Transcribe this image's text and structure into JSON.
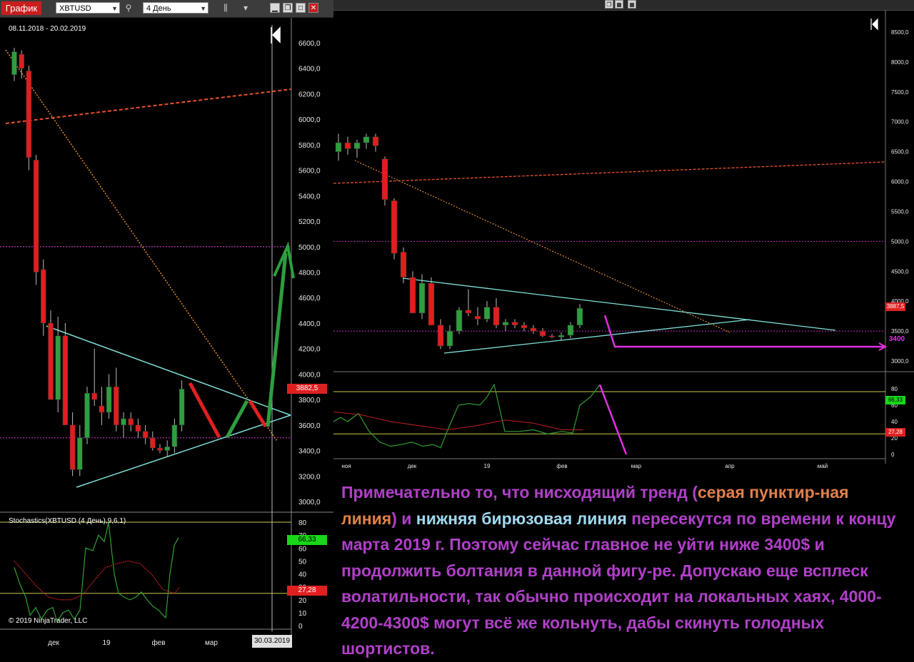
{
  "left_window": {
    "title": "График",
    "symbol": "XBTUSD",
    "interval": "4 День",
    "date_range": "08.11.2018 - 20.02.2019",
    "indicator_title": "Stochastics(XBTUSD (4 День),9,6,1)",
    "copyright": "© 2019 NinjaTrader, LLC",
    "date_badge": "30.03.2019",
    "price_tag_main": "3882,5",
    "price_tag_stoch_high": "66,33",
    "price_tag_stoch_low": "27,28",
    "price_axis": [
      "6600,0",
      "6400,0",
      "6200,0",
      "6000,0",
      "5800,0",
      "5600,0",
      "5400,0",
      "5200,0",
      "5000,0",
      "4800,0",
      "4600,0",
      "4400,0",
      "4200,0",
      "4000,0",
      "3800,0",
      "3600,0",
      "3400,0",
      "3200,0",
      "3000,0"
    ],
    "stoch_axis": [
      "80",
      "70",
      "60",
      "50",
      "40",
      "30",
      "20",
      "10",
      "0"
    ],
    "time_axis": [
      "дек",
      "19",
      "фев",
      "мар"
    ],
    "colors": {
      "up": "#2e9e3e",
      "down": "#e01e1e",
      "trend": "#e08a2c",
      "resistance": "#e8502a",
      "cyan": "#7fe0d8",
      "level": "#c030c0",
      "arrow_green": "#2e9e3e",
      "stoch_k": "#2ea030",
      "stoch_d": "#c02020",
      "stoch_levels": "#c8c850"
    }
  },
  "right_window": {
    "price_axis": [
      "8500,0",
      "8000,0",
      "7500,0",
      "7000,0",
      "6500,0",
      "6000,0",
      "5500,0",
      "5000,0",
      "4500,0",
      "4000,0",
      "3500,0",
      "3000,0"
    ],
    "stoch_axis": [
      "80",
      "60",
      "40",
      "20",
      "0"
    ],
    "time_axis": [
      "ноя",
      "дек",
      "19",
      "фев",
      "мар",
      "апр",
      "май"
    ],
    "price_tag": "3887,5",
    "level_label": "3400",
    "stoch_tag_high": "66,33",
    "stoch_tag_low": "27,28"
  },
  "caption": {
    "part1": "Примечательно то, что нисходящий тренд (",
    "part2": "серая пунктир-ная линия",
    "part3": ") и ",
    "part4": "нижняя бирюзовая линия",
    "part5": " пересекутся по времени к концу марта 2019 г. Поэтому сейчас главное не уйти ниже 3400$ и продолжить болтания в данной фигу-ре. Допускаю еще всплеск волатильности, так обычно происходит на локальных хаях, 4000-4200-4300$ могут всё же кольнуть, дабы скинуть голодных шортистов."
  },
  "chart_data": [
    {
      "type": "candlestick",
      "title": "",
      "symbol": "XBTUSD",
      "interval": "4 День",
      "y_range": [
        3000,
        6600
      ],
      "candles": [
        {
          "o": 6350,
          "h": 6560,
          "l": 6300,
          "c": 6530
        },
        {
          "o": 6510,
          "h": 6540,
          "l": 6320,
          "c": 6400
        },
        {
          "o": 6380,
          "h": 6420,
          "l": 5600,
          "c": 5700
        },
        {
          "o": 5680,
          "h": 5720,
          "l": 4700,
          "c": 4800
        },
        {
          "o": 4820,
          "h": 4900,
          "l": 4300,
          "c": 4400
        },
        {
          "o": 4400,
          "h": 4500,
          "l": 3800,
          "c": 3800
        },
        {
          "o": 3800,
          "h": 4450,
          "l": 3700,
          "c": 4300
        },
        {
          "o": 4300,
          "h": 4400,
          "l": 3600,
          "c": 3600
        },
        {
          "o": 3600,
          "h": 3700,
          "l": 3200,
          "c": 3250
        },
        {
          "o": 3250,
          "h": 3600,
          "l": 3200,
          "c": 3500
        },
        {
          "o": 3500,
          "h": 3900,
          "l": 3450,
          "c": 3850
        },
        {
          "o": 3850,
          "h": 4200,
          "l": 3750,
          "c": 3800
        },
        {
          "o": 3750,
          "h": 3900,
          "l": 3600,
          "c": 3700
        },
        {
          "o": 3700,
          "h": 4000,
          "l": 3650,
          "c": 3900
        },
        {
          "o": 3900,
          "h": 4050,
          "l": 3550,
          "c": 3600
        },
        {
          "o": 3600,
          "h": 3700,
          "l": 3500,
          "c": 3650
        },
        {
          "o": 3650,
          "h": 3700,
          "l": 3550,
          "c": 3600
        },
        {
          "o": 3600,
          "h": 3650,
          "l": 3500,
          "c": 3550
        },
        {
          "o": 3550,
          "h": 3600,
          "l": 3450,
          "c": 3500
        },
        {
          "o": 3500,
          "h": 3550,
          "l": 3400,
          "c": 3420
        },
        {
          "o": 3420,
          "h": 3450,
          "l": 3380,
          "c": 3400
        },
        {
          "o": 3400,
          "h": 3480,
          "l": 3350,
          "c": 3430
        },
        {
          "o": 3430,
          "h": 3650,
          "l": 3380,
          "c": 3600
        },
        {
          "o": 3600,
          "h": 3950,
          "l": 3550,
          "c": 3882.5
        }
      ],
      "levels": [
        5000,
        3500
      ],
      "stochastics": {
        "k_last": 66.33,
        "d_last": 27.28,
        "levels": [
          80,
          20
        ]
      }
    },
    {
      "type": "candlestick",
      "title": "",
      "symbol": "XBTUSD",
      "interval": "4 День",
      "y_range": [
        3000,
        8500
      ],
      "last_price": 3887.5,
      "target_level": 3400,
      "levels": [
        5000,
        3500
      ]
    }
  ]
}
